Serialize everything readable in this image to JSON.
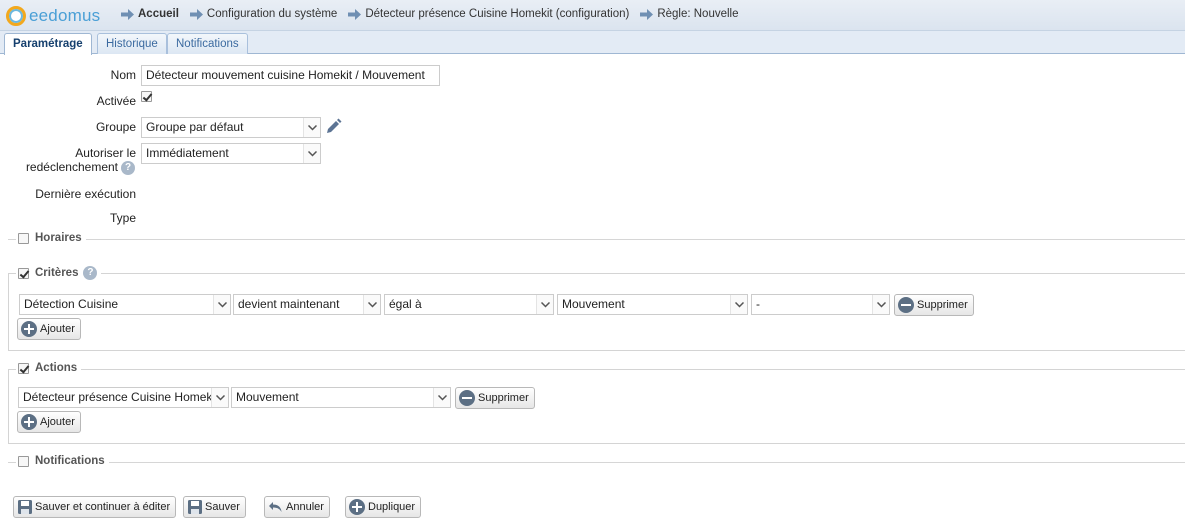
{
  "app": {
    "logo_text": "eedomus"
  },
  "breadcrumb": [
    {
      "label": "Accueil"
    },
    {
      "label": "Configuration du système"
    },
    {
      "label": "Détecteur présence Cuisine Homekit (configuration)"
    },
    {
      "label": "Règle: Nouvelle"
    }
  ],
  "tabs": [
    {
      "label": "Paramétrage",
      "active": true
    },
    {
      "label": "Historique",
      "active": false
    },
    {
      "label": "Notifications",
      "active": false
    }
  ],
  "form": {
    "nom_label": "Nom",
    "nom_value": "Détecteur mouvement cuisine Homekit / Mouvement",
    "activee_label": "Activée",
    "activee_checked": true,
    "groupe_label": "Groupe",
    "groupe_value": "Groupe par défaut",
    "autoriser_label_1": "Autoriser le",
    "autoriser_label_2": "redéclenchement",
    "autoriser_value": "Immédiatement",
    "derniere_label": "Dernière exécution",
    "type_label": "Type"
  },
  "sections": {
    "horaires": {
      "label": "Horaires",
      "checked": false
    },
    "criteres": {
      "label": "Critères",
      "checked": true
    },
    "actions": {
      "label": "Actions",
      "checked": true
    },
    "notifications": {
      "label": "Notifications",
      "checked": false
    }
  },
  "criteria_row": {
    "device": "Détection Cuisine",
    "change": "devient maintenant",
    "operator": "égal à",
    "value": "Mouvement",
    "extra": "-",
    "delete_label": "Supprimer"
  },
  "action_row": {
    "device": "Détecteur présence Cuisine Homekit",
    "value": "Mouvement",
    "delete_label": "Supprimer"
  },
  "add_label": "Ajouter",
  "footer": {
    "save_continue": "Sauver et continuer à éditer",
    "save": "Sauver",
    "cancel": "Annuler",
    "duplicate": "Dupliquer"
  },
  "colors": {
    "accent": "#3b6aa0",
    "icon_gray": "#5c6f84",
    "logo_orange": "#f2a81d",
    "logo_blue": "#4a9fd6"
  }
}
